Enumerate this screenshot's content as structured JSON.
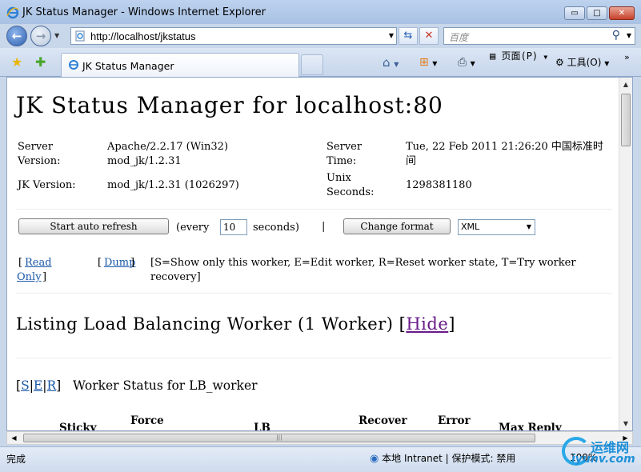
{
  "window": {
    "title": "JK Status Manager - Windows Internet Explorer",
    "min_symbol": "▭",
    "max_symbol": "□",
    "close_symbol": "✕"
  },
  "address": {
    "url": "http://localhost/jkstatus",
    "search_placeholder": "百度"
  },
  "tabs": [
    {
      "label": "JK Status Manager"
    }
  ],
  "commands": {
    "page_label": "页面(P)",
    "tools_label": "工具(O)"
  },
  "page": {
    "title": "JK Status Manager for localhost:80",
    "server_version_label": "Server Version:",
    "server_version_value": "Apache/2.2.17 (Win32) mod_jk/1.2.31",
    "server_time_label": "Server Time:",
    "server_time_value": "Tue, 22 Feb 2011 21:26:20 中国标准时间",
    "jk_version_label": "JK Version:",
    "jk_version_value": "mod_jk/1.2.31 (1026297)",
    "unix_seconds_label": "Unix Seconds:",
    "unix_seconds_value": "1298381180",
    "auto_refresh_button": "Start auto refresh",
    "every_label": "(every",
    "refresh_interval": "10",
    "seconds_label": "seconds)",
    "separator": "|",
    "change_format_button": "Change format",
    "format_value": "XML",
    "read_only_link": "Read Only",
    "dump_link": "Dump",
    "legend_text": "[S=Show only this worker, E=Edit worker, R=Reset worker state, T=Try worker recovery]",
    "section_title": "Listing Load Balancing Worker (1 Worker)",
    "hide_link": "Hide",
    "worker_links": [
      "S",
      "E",
      "R"
    ],
    "worker_status_title": "Worker Status for LB_worker",
    "column_headers": [
      "Sticky",
      "Force",
      "LB",
      "Recover",
      "Error",
      "Max Reply"
    ]
  },
  "status": {
    "text": "完成",
    "zone": "本地 Intranet | 保护模式: 禁用",
    "zoom": "100%"
  },
  "watermark": {
    "line1": "运维网",
    "line2": "iyunv.com"
  }
}
